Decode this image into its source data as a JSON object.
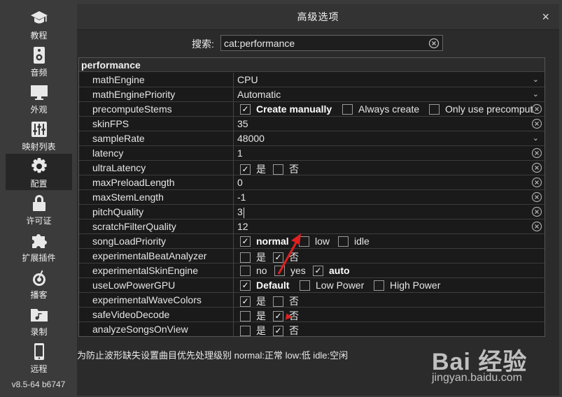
{
  "sidebar": {
    "items": [
      {
        "label": "教程",
        "icon": "graduation-cap-icon"
      },
      {
        "label": "音频",
        "icon": "speaker-icon"
      },
      {
        "label": "外观",
        "icon": "monitor-icon"
      },
      {
        "label": "映射列表",
        "icon": "sliders-icon"
      },
      {
        "label": "配置",
        "icon": "gear-icon"
      },
      {
        "label": "许可证",
        "icon": "lock-icon"
      },
      {
        "label": "扩展插件",
        "icon": "puzzle-icon"
      },
      {
        "label": "播客",
        "icon": "podcast-icon"
      },
      {
        "label": "录制",
        "icon": "folder-music-icon"
      },
      {
        "label": "远程",
        "icon": "phone-icon"
      }
    ],
    "active": "配置",
    "version": "v8.5-64 b6747"
  },
  "dialog": {
    "title": "高级选项",
    "close_glyph": "×"
  },
  "search": {
    "label": "搜索:",
    "value": "cat:performance"
  },
  "table": {
    "group": "performance",
    "rows": [
      {
        "name": "mathEngine",
        "value": "CPU"
      },
      {
        "name": "mathEnginePriority",
        "value": "Automatic"
      },
      {
        "name": "precomputeStems",
        "options": [
          "Create manually",
          "Always create",
          "Only use precompute"
        ]
      },
      {
        "name": "skinFPS",
        "value": "35"
      },
      {
        "name": "sampleRate",
        "value": "48000"
      },
      {
        "name": "latency",
        "value": "1"
      },
      {
        "name": "ultraLatency",
        "options": [
          "是",
          "否"
        ]
      },
      {
        "name": "maxPreloadLength",
        "value": "0"
      },
      {
        "name": "maxStemLength",
        "value": "-1"
      },
      {
        "name": "pitchQuality",
        "value": "3"
      },
      {
        "name": "scratchFilterQuality",
        "value": "12"
      },
      {
        "name": "songLoadPriority",
        "options": [
          "normal",
          "low",
          "idle"
        ]
      },
      {
        "name": "experimentalBeatAnalyzer",
        "options": [
          "是",
          "否"
        ]
      },
      {
        "name": "experimentalSkinEngine",
        "options": [
          "no",
          "yes",
          "auto"
        ]
      },
      {
        "name": "useLowPowerGPU",
        "options": [
          "Default",
          "Low Power",
          "High Power"
        ]
      },
      {
        "name": "experimentalWaveColors",
        "options": [
          "是",
          "否"
        ]
      },
      {
        "name": "safeVideoDecode",
        "options": [
          "是",
          "否"
        ]
      },
      {
        "name": "analyzeSongsOnView",
        "options": [
          "是",
          "否"
        ]
      }
    ]
  },
  "hint": "为防止波形缺失设置曲目优先处理级别  normal:正常  low:低  idle:空闲",
  "watermark": {
    "brand": "Bai 经验",
    "url": "jingyan.baidu.com"
  },
  "colors": {
    "annotation_red": "#e02020",
    "background": "#2b2b2b"
  }
}
